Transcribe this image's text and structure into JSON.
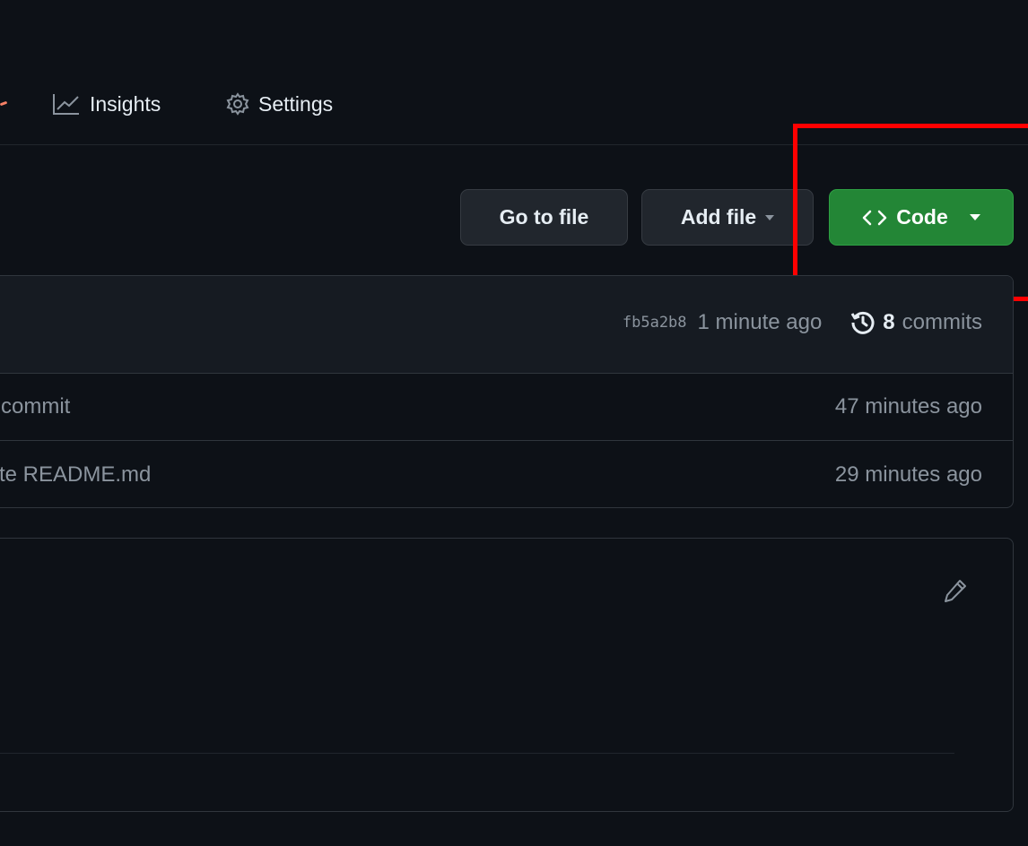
{
  "nav": {
    "items": [
      {
        "label": "Insights",
        "icon": "graph-icon"
      },
      {
        "label": "Settings",
        "icon": "gear-icon"
      }
    ]
  },
  "toolbar": {
    "go_to_file": "Go to file",
    "add_file": "Add file",
    "code": "Code"
  },
  "latest_commit": {
    "sha": "fb5a2b8",
    "time": "1 minute ago",
    "count": "8",
    "count_label": "commits"
  },
  "files": [
    {
      "message": "commit",
      "time": "47 minutes ago"
    },
    {
      "message": "te README.md",
      "time": "29 minutes ago"
    }
  ],
  "colors": {
    "background": "#0d1117",
    "code_button": "#238636",
    "highlight": "#ff0000"
  }
}
